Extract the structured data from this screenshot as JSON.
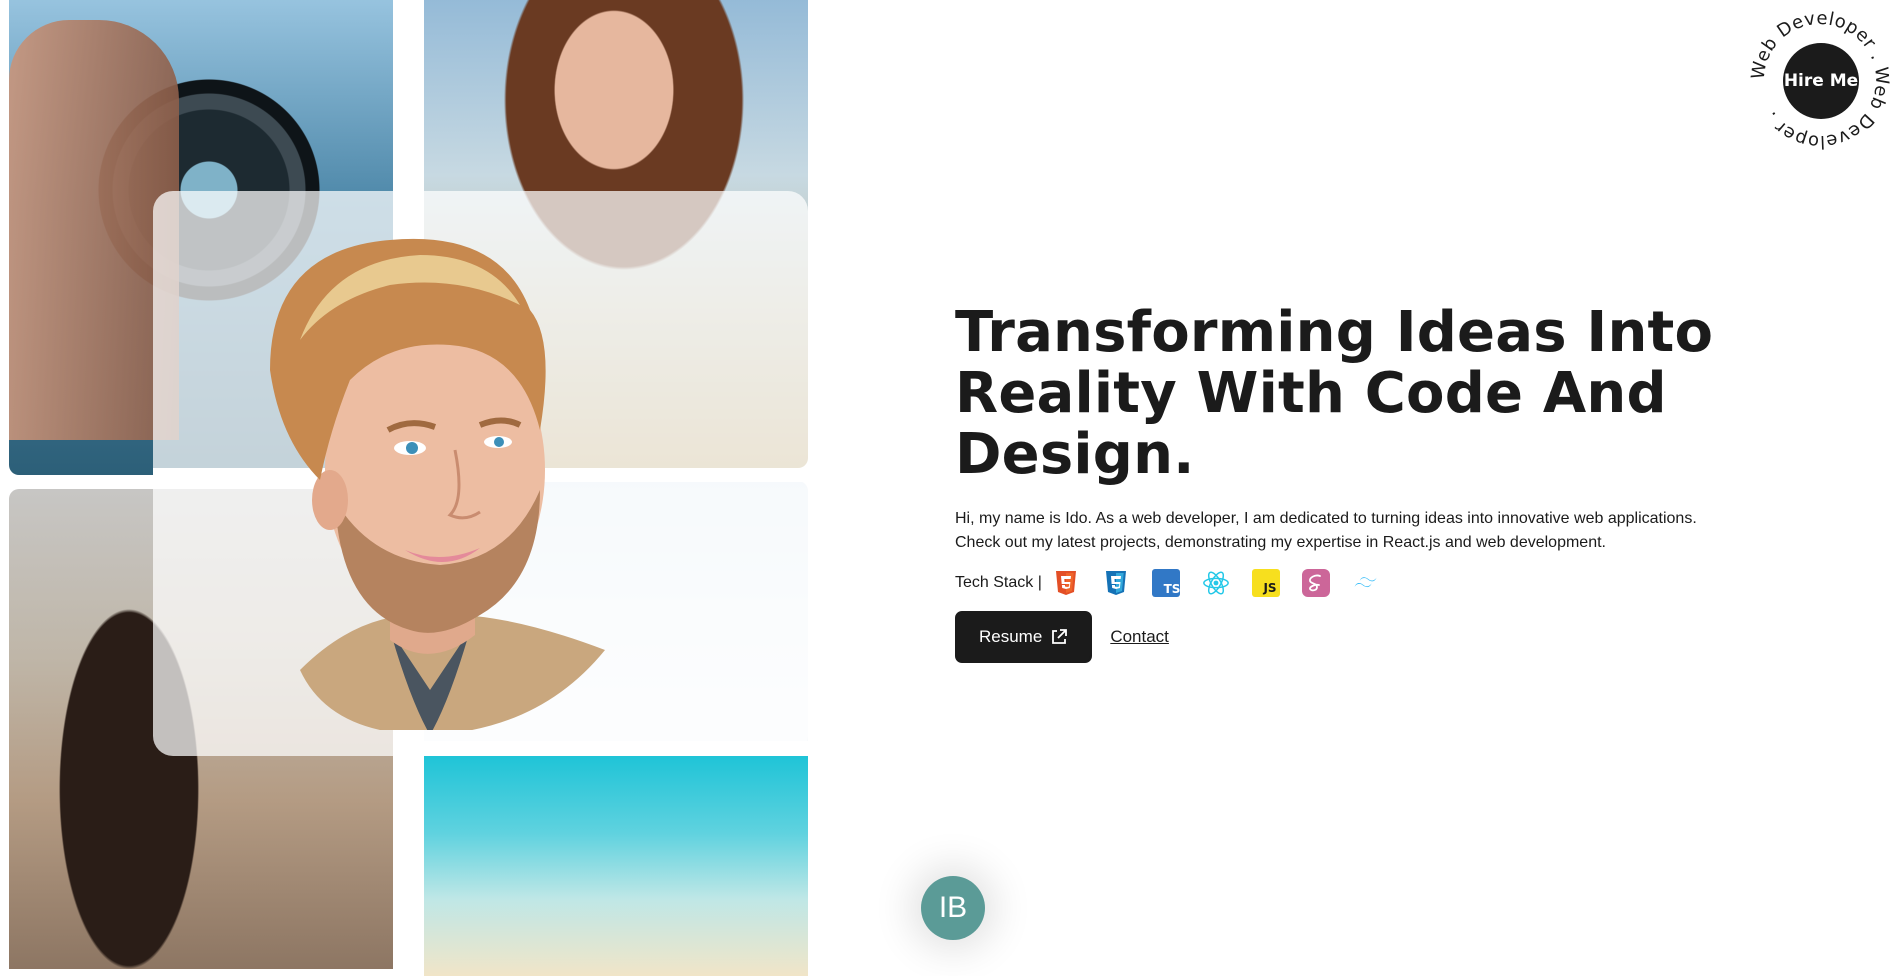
{
  "hero": {
    "title_line1": "Transforming Ideas Into",
    "title_line2": "Reality With Code And",
    "title_line3": "Design.",
    "intro_line1": "Hi, my name is Ido. As a web developer, I am dedicated to turning ideas into innovative web applications.",
    "intro_line2": "Check out my latest projects, demonstrating my expertise in React.js and web development."
  },
  "tech_stack": {
    "label": "Tech Stack |",
    "icons": [
      "html5-icon",
      "css3-icon",
      "typescript-icon",
      "react-icon",
      "javascript-icon",
      "sass-icon",
      "tailwind-icon"
    ],
    "ts_text": "TS",
    "js_text": "JS"
  },
  "actions": {
    "resume_label": "Resume",
    "contact_label": "Contact"
  },
  "hire": {
    "button_label": "Hire Me",
    "ring_text": "Web Developer . Web Developer . "
  },
  "avatar_badge": {
    "initials": "IB",
    "color": "#5b9b97"
  },
  "colors": {
    "dark": "#1b1b1b",
    "html": "#e34f26",
    "css": "#1572b6",
    "ts": "#3178c6",
    "react": "#61dafb",
    "js": "#f7df1e",
    "sass": "#cc6699",
    "tailwind": "#38bdf8"
  }
}
